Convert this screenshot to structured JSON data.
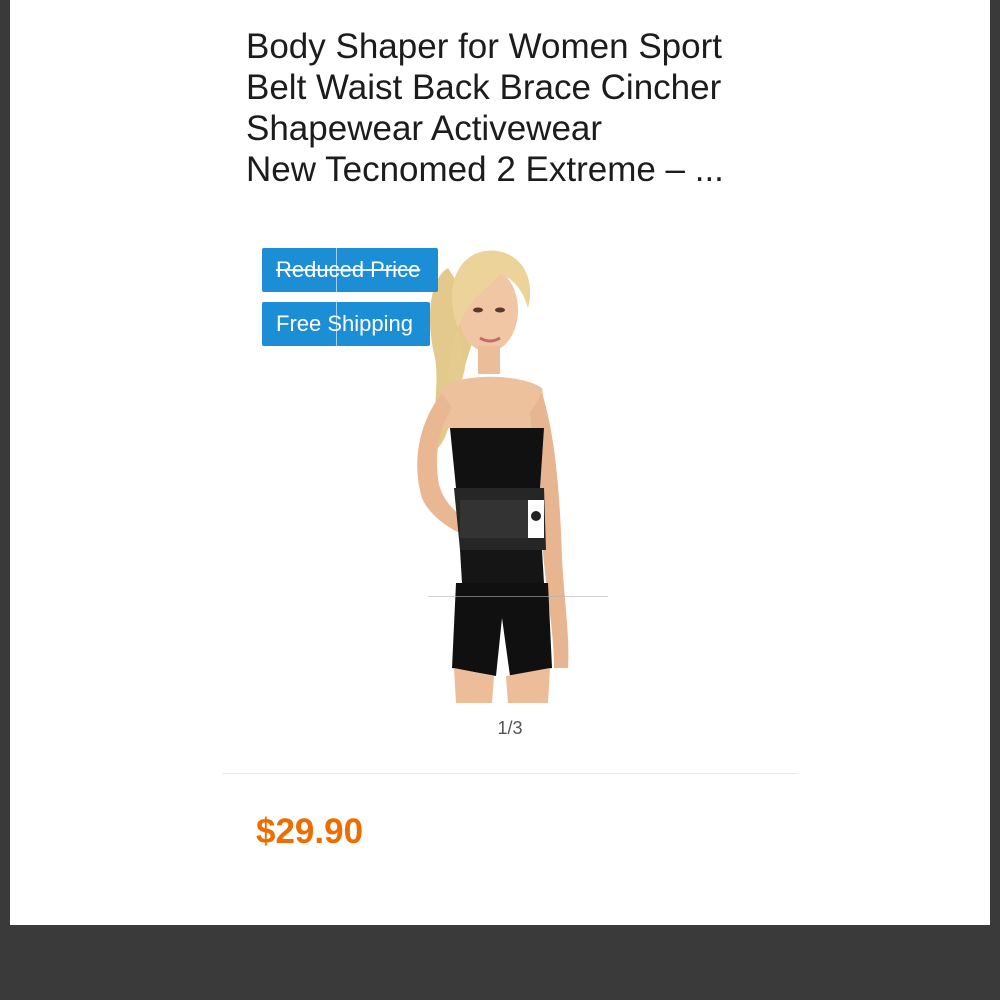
{
  "product": {
    "title_lines": [
      "Body Shaper for Women Sport",
      "Belt Waist Back Brace Cincher",
      "Shapewear Activewear",
      "New Tecnomed 2 Extreme – ..."
    ],
    "badges": {
      "reduced": "Reduced Price",
      "shipping": "Free Shipping"
    },
    "pager": "1/3",
    "price": "$29.90"
  },
  "colors": {
    "badge": "#1b8ed6",
    "price": "#ef6c00",
    "title": "#1c1c1c"
  }
}
